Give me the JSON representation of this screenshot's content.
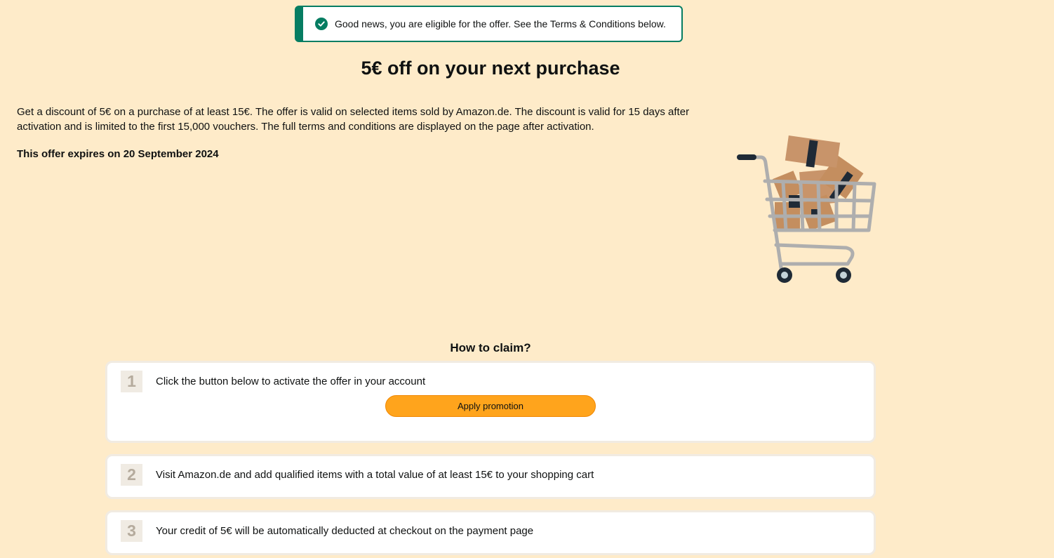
{
  "alert": {
    "icon": "check-circle-icon",
    "color": "#067d62",
    "text": "Good news, you are eligible for the offer. See the Terms & Conditions below."
  },
  "offer": {
    "title": "5€ off on your next purchase",
    "description": "Get a discount of 5€ on a purchase of at least 15€. The offer is valid on selected items sold by Amazon.de. The discount is valid for 15 days after activation and is limited to the first 15,000 vouchers. The full terms and conditions are displayed on the page after activation.",
    "expiry": "This offer expires on 20 September 2024",
    "image": "shopping-cart-with-boxes-illustration"
  },
  "how_to_claim": {
    "title": "How to claim?",
    "steps": [
      {
        "number": "1",
        "text": "Click the button below to activate the offer in your account",
        "button_label": "Apply promotion"
      },
      {
        "number": "2",
        "text": "Visit Amazon.de and add qualified items with a total value of at least 15€ to your shopping cart"
      },
      {
        "number": "3",
        "text": "Your credit of 5€ will be automatically deducted at checkout on the payment page"
      }
    ]
  },
  "colors": {
    "page_background": "#feebc9",
    "button": "#ffa41c",
    "success": "#067d62"
  }
}
